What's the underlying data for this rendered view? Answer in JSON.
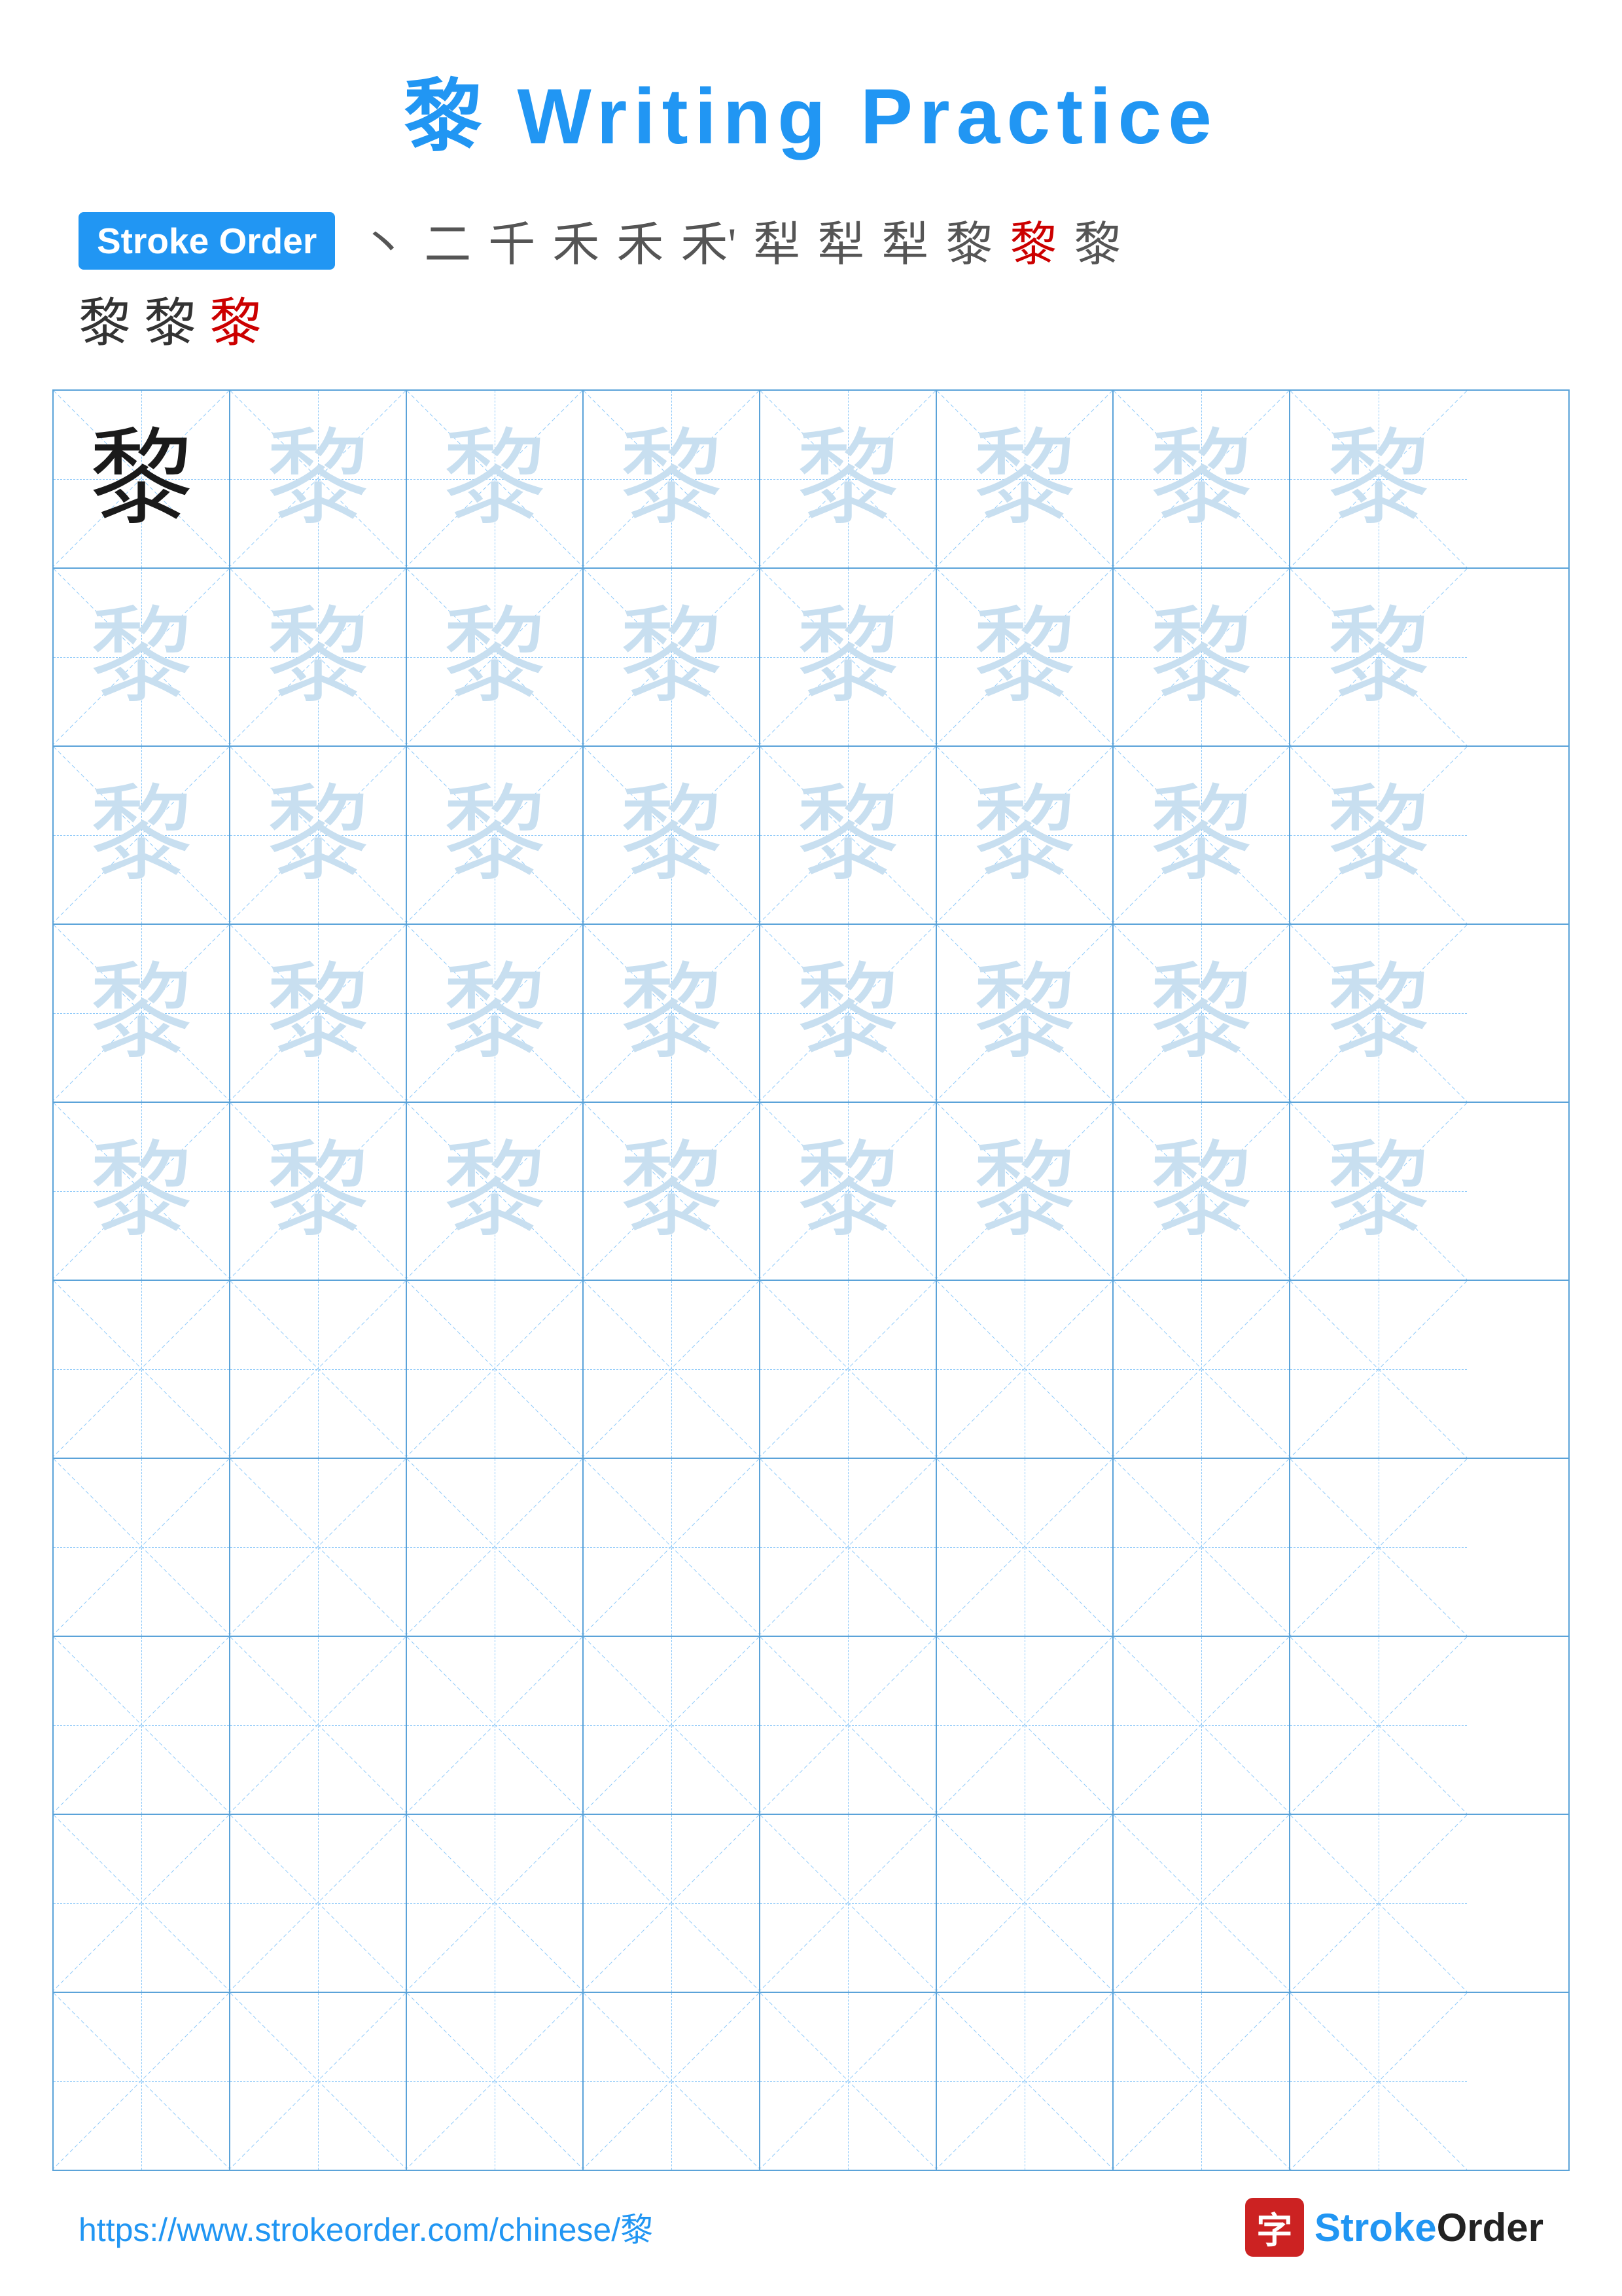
{
  "page": {
    "title": "黎 Writing Practice",
    "char": "黎",
    "title_color": "#2196F3"
  },
  "stroke_order": {
    "badge_label": "Stroke Order",
    "strokes": [
      "丶",
      "二",
      "千",
      "禾",
      "禾",
      "禾'",
      "犁",
      "犁0",
      "犁2",
      "黎",
      "黎¹",
      "黎²",
      "黎",
      "黎",
      "黎"
    ],
    "row2_chars": [
      "黎",
      "黎",
      "黎"
    ]
  },
  "grid": {
    "rows": 10,
    "cols": 8,
    "char": "黎"
  },
  "footer": {
    "url": "https://www.strokeorder.com/chinese/黎",
    "logo_char": "字",
    "logo_text": "StrokeOrder"
  }
}
